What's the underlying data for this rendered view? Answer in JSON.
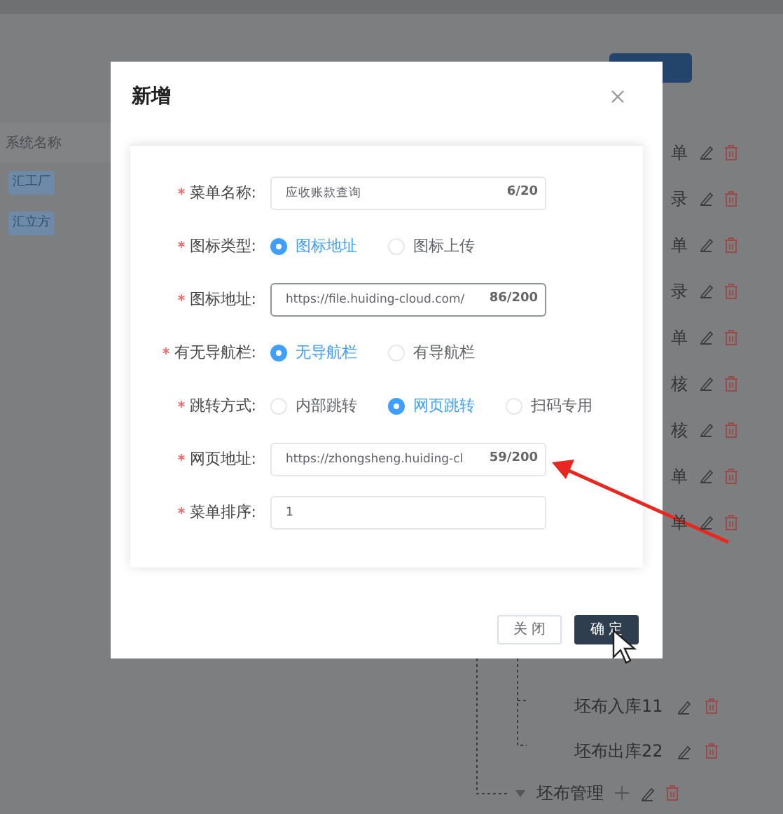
{
  "background": {
    "table": {
      "header": "系统名称",
      "tags": [
        "汇工厂",
        "汇立方"
      ]
    },
    "tree_rows": [
      {
        "text": "单"
      },
      {
        "text": "录"
      },
      {
        "text": "单"
      },
      {
        "text": "录"
      },
      {
        "text": "单"
      },
      {
        "text": "核"
      },
      {
        "text": "核"
      },
      {
        "text": "单"
      },
      {
        "text": "单"
      }
    ],
    "tree_children": [
      {
        "label": "坯布入库11"
      },
      {
        "label": "坯布出库22"
      }
    ],
    "tree_parent": {
      "label": "坯布管理",
      "expanded": true
    }
  },
  "dialog": {
    "title": "新增",
    "fields": [
      {
        "kind": "input",
        "label": "菜单名称:",
        "required": true,
        "value": "应收账款查询",
        "counter": "6/20",
        "focused": false
      },
      {
        "kind": "radio",
        "label": "图标类型:",
        "required": true,
        "options": [
          {
            "label": "图标地址",
            "selected": true
          },
          {
            "label": "图标上传",
            "selected": false
          }
        ]
      },
      {
        "kind": "input",
        "label": "图标地址:",
        "required": true,
        "value": "https://file.huiding-cloud.com/",
        "counter": "86/200",
        "focused": true
      },
      {
        "kind": "radio",
        "label": "有无导航栏:",
        "required": true,
        "options": [
          {
            "label": "无导航栏",
            "selected": true
          },
          {
            "label": "有导航栏",
            "selected": false
          }
        ]
      },
      {
        "kind": "radio",
        "label": "跳转方式:",
        "required": true,
        "options": [
          {
            "label": "内部跳转",
            "selected": false
          },
          {
            "label": "网页跳转",
            "selected": true
          },
          {
            "label": "扫码专用",
            "selected": false
          }
        ]
      },
      {
        "kind": "input",
        "label": "网页地址:",
        "required": true,
        "value": "https://zhongsheng.huiding-cl",
        "counter": "59/200",
        "focused": false
      },
      {
        "kind": "input",
        "label": "菜单排序:",
        "required": true,
        "value": "1",
        "focused": false
      }
    ],
    "buttons": [
      {
        "label": "关闭",
        "kind": "default"
      },
      {
        "label": "确定",
        "kind": "primary"
      }
    ]
  }
}
